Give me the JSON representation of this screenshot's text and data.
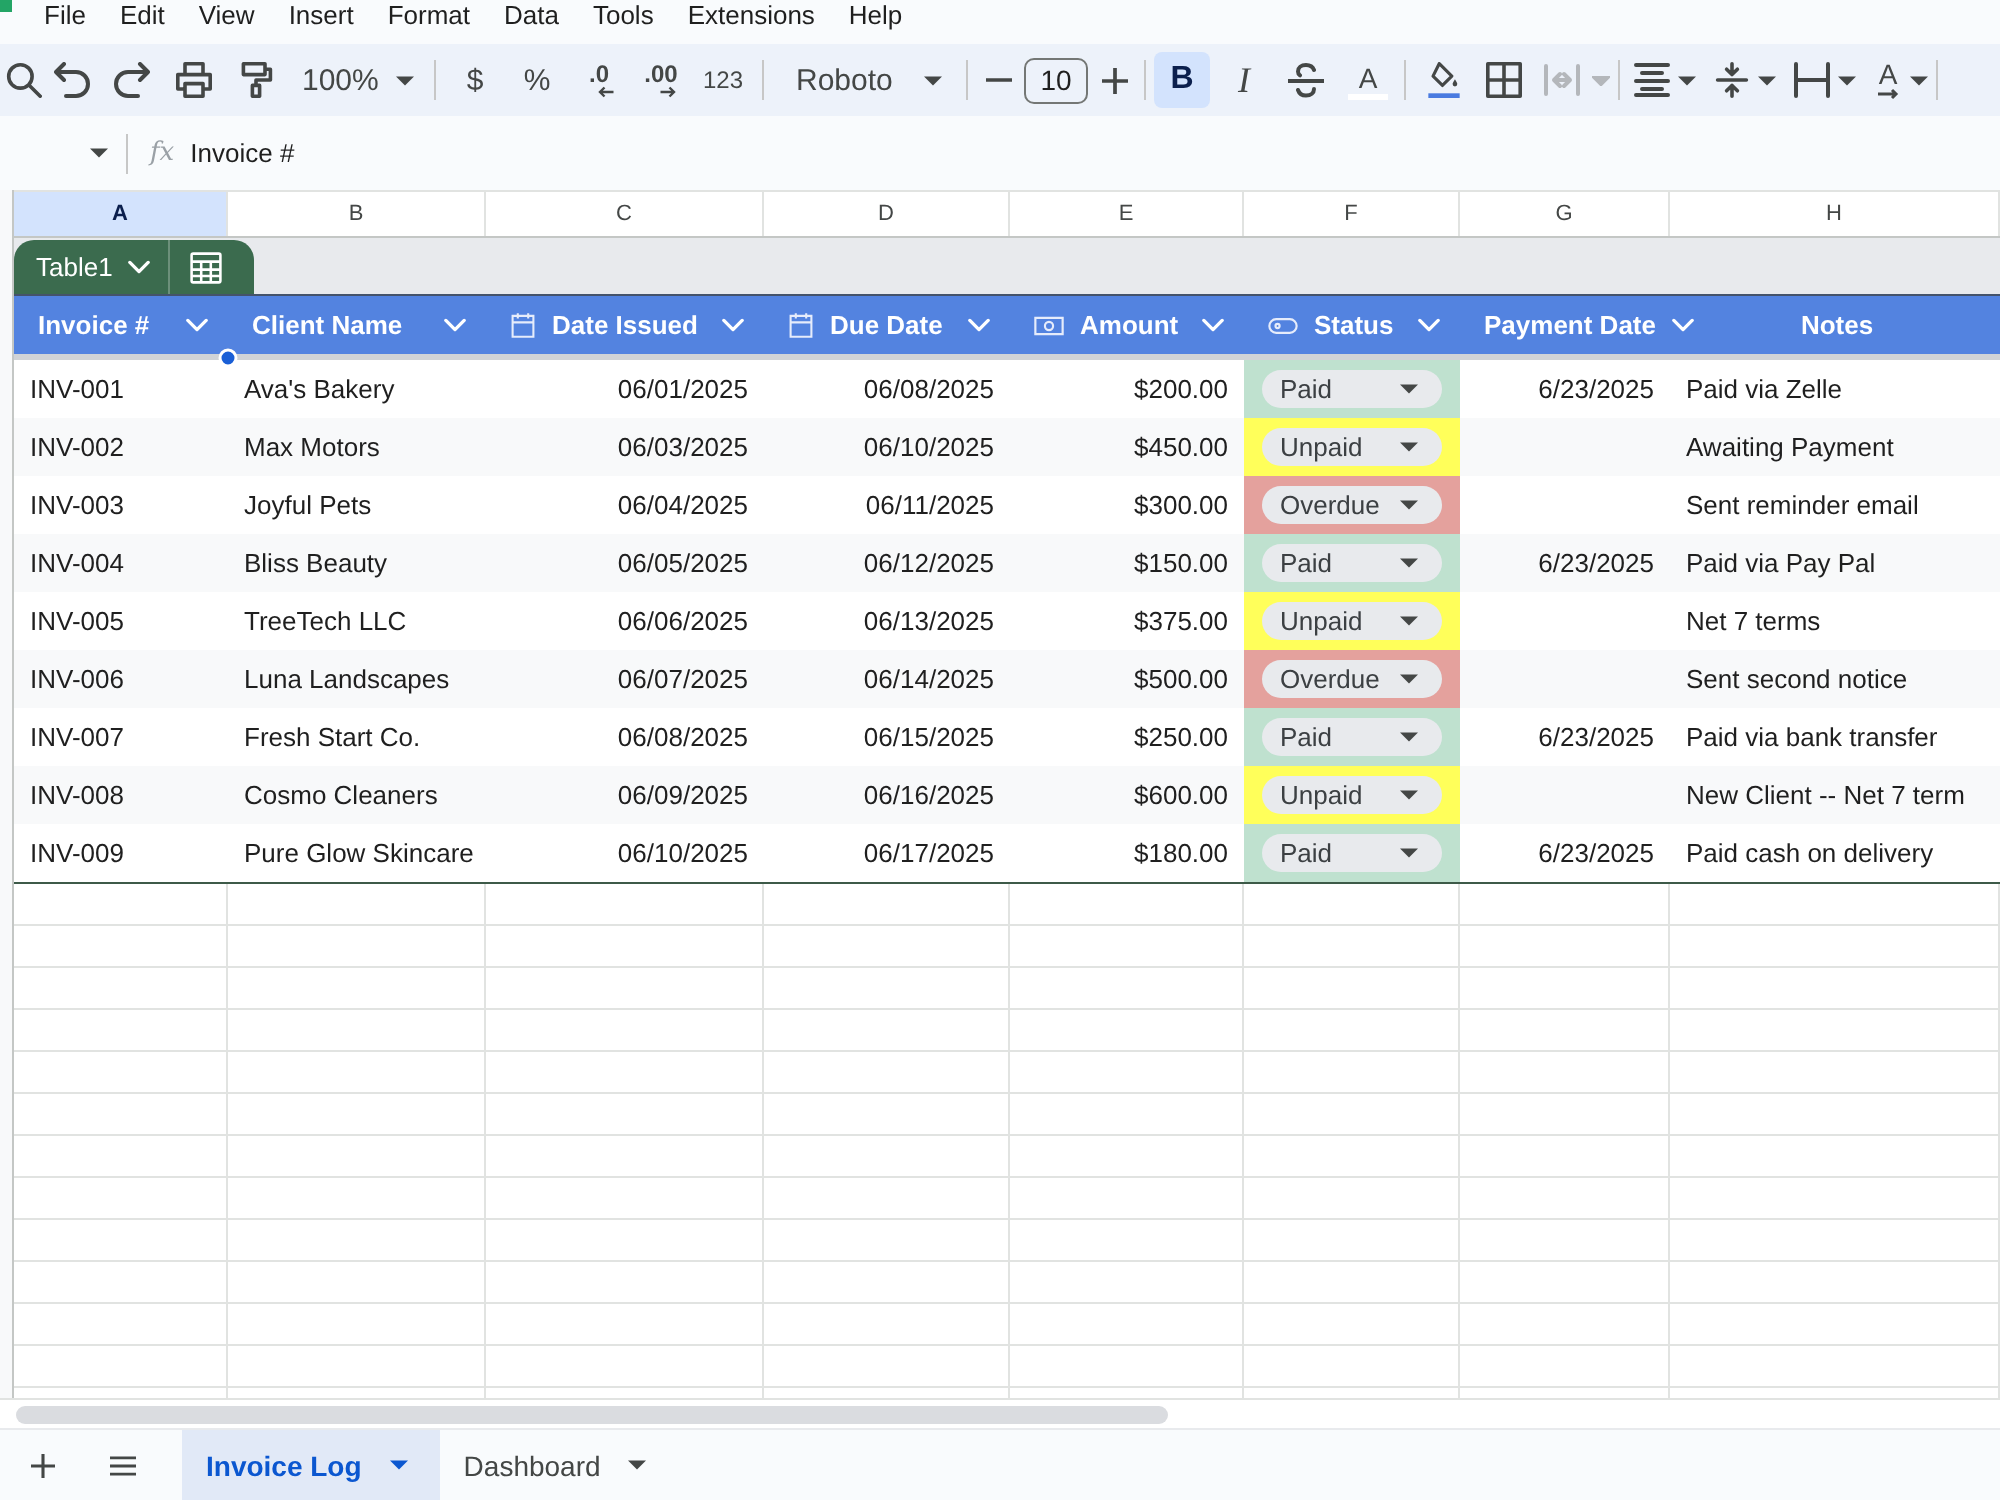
{
  "menu": [
    "File",
    "Edit",
    "View",
    "Insert",
    "Format",
    "Data",
    "Tools",
    "Extensions",
    "Help"
  ],
  "toolbar": {
    "zoom": "100%",
    "currency": "$",
    "percent": "%",
    "decrease_decimal": ".0",
    "increase_decimal": ".00",
    "more_formats": "123",
    "font": "Roboto",
    "font_size": "10",
    "styles": [
      {
        "kind": "bold",
        "label": "B",
        "selected": true
      },
      {
        "kind": "italic",
        "label": "I",
        "selected": false
      },
      {
        "kind": "strikethrough",
        "selected": false
      }
    ],
    "text_color": "A",
    "merge": {
      "disabled": true
    },
    "text_rotation": "A"
  },
  "formula_bar": {
    "function_label": "fx",
    "value": "Invoice #"
  },
  "column_letters": [
    {
      "label": "A",
      "selected": true
    },
    {
      "label": "B",
      "selected": false
    },
    {
      "label": "C",
      "selected": false
    },
    {
      "label": "D",
      "selected": false
    },
    {
      "label": "E",
      "selected": false
    },
    {
      "label": "F",
      "selected": false
    },
    {
      "label": "G",
      "selected": false
    },
    {
      "label": "H",
      "selected": false
    }
  ],
  "table": {
    "name": "Table1",
    "columns": [
      {
        "label": "Invoice #",
        "kind": "plain",
        "filter": true
      },
      {
        "label": "Client Name",
        "kind": "plain",
        "filter": true
      },
      {
        "label": "Date Issued",
        "kind": "date",
        "filter": true
      },
      {
        "label": "Due Date",
        "kind": "date",
        "filter": true
      },
      {
        "label": "Amount",
        "kind": "currency",
        "filter": true
      },
      {
        "label": "Status",
        "kind": "dropdown",
        "filter": true
      },
      {
        "label": "Payment Date",
        "kind": "plain",
        "filter": true
      },
      {
        "label": "Notes",
        "kind": "plain",
        "filter": false
      }
    ],
    "rows": [
      {
        "invoice_no": "INV-001",
        "client_name": "Ava's Bakery",
        "date_issued": "06/01/2025",
        "due_date": "06/08/2025",
        "amount": "$200.00",
        "status": {
          "label": "Paid",
          "color": "#bfe1cf"
        },
        "payment_date": "6/23/2025",
        "notes": "Paid via Zelle"
      },
      {
        "invoice_no": "INV-002",
        "client_name": "Max Motors",
        "date_issued": "06/03/2025",
        "due_date": "06/10/2025",
        "amount": "$450.00",
        "status": {
          "label": "Unpaid",
          "color": "#ffff5a"
        },
        "notes": "Awaiting Payment"
      },
      {
        "invoice_no": "INV-003",
        "client_name": "Joyful Pets",
        "date_issued": "06/04/2025",
        "due_date": "06/11/2025",
        "amount": "$300.00",
        "status": {
          "label": "Overdue",
          "color": "#e4a19d"
        },
        "notes": "Sent reminder email"
      },
      {
        "invoice_no": "INV-004",
        "client_name": "Bliss Beauty",
        "date_issued": "06/05/2025",
        "due_date": "06/12/2025",
        "amount": "$150.00",
        "status": {
          "label": "Paid",
          "color": "#bfe1cf"
        },
        "payment_date": "6/23/2025",
        "notes": "Paid via Pay Pal"
      },
      {
        "invoice_no": "INV-005",
        "client_name": "TreeTech LLC",
        "date_issued": "06/06/2025",
        "due_date": "06/13/2025",
        "amount": "$375.00",
        "status": {
          "label": "Unpaid",
          "color": "#ffff5a"
        },
        "notes": "Net 7 terms"
      },
      {
        "invoice_no": "INV-006",
        "client_name": "Luna Landscapes",
        "date_issued": "06/07/2025",
        "due_date": "06/14/2025",
        "amount": "$500.00",
        "status": {
          "label": "Overdue",
          "color": "#e4a19d"
        },
        "notes": "Sent second notice"
      },
      {
        "invoice_no": "INV-007",
        "client_name": "Fresh Start Co.",
        "date_issued": "06/08/2025",
        "due_date": "06/15/2025",
        "amount": "$250.00",
        "status": {
          "label": "Paid",
          "color": "#bfe1cf"
        },
        "payment_date": "6/23/2025",
        "notes": "Paid via bank transfer"
      },
      {
        "invoice_no": "INV-008",
        "client_name": "Cosmo Cleaners",
        "date_issued": "06/09/2025",
        "due_date": "06/16/2025",
        "amount": "$600.00",
        "status": {
          "label": "Unpaid",
          "color": "#ffff5a"
        },
        "notes": "New Client -- Net 7 term"
      },
      {
        "invoice_no": "INV-009",
        "client_name": "Pure Glow Skincare",
        "date_issued": "06/10/2025",
        "due_date": "06/17/2025",
        "amount": "$180.00",
        "status": {
          "label": "Paid",
          "color": "#bfe1cf"
        },
        "payment_date": "6/23/2025",
        "notes": "Paid cash on delivery"
      }
    ]
  },
  "sheet_tabs": [
    {
      "label": "Invoice Log",
      "selected": true
    },
    {
      "label": "Dashboard",
      "selected": false
    }
  ]
}
